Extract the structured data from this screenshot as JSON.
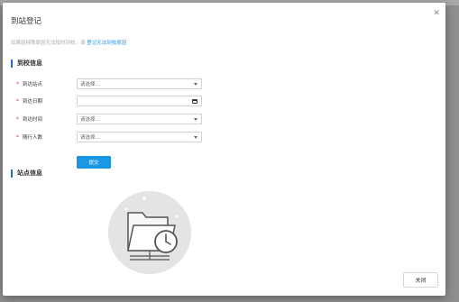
{
  "dialog": {
    "title": "到站登记",
    "notice_text": "如果因特殊原因无法按时到校，请 ",
    "notice_link": "登记无法到校原因"
  },
  "sections": {
    "school_info": "到校信息",
    "station_info": "站点信息"
  },
  "form": {
    "fields": [
      {
        "label": "到达站点",
        "value": "请选择...",
        "type": "select"
      },
      {
        "label": "到达日期",
        "value": "",
        "type": "date"
      },
      {
        "label": "到达时间",
        "value": "请选择...",
        "type": "select"
      },
      {
        "label": "随行人数",
        "value": "请选择...",
        "type": "select"
      }
    ],
    "required_mark": "*",
    "submit_label": "提交"
  },
  "footer": {
    "close_label": "关闭"
  },
  "icons": {
    "close": "close-icon",
    "empty": "folder-clock-icon"
  },
  "colors": {
    "accent": "#1a98e4",
    "section_bar": "#1b72c7",
    "required": "#e04040",
    "link": "#1f95e6"
  }
}
